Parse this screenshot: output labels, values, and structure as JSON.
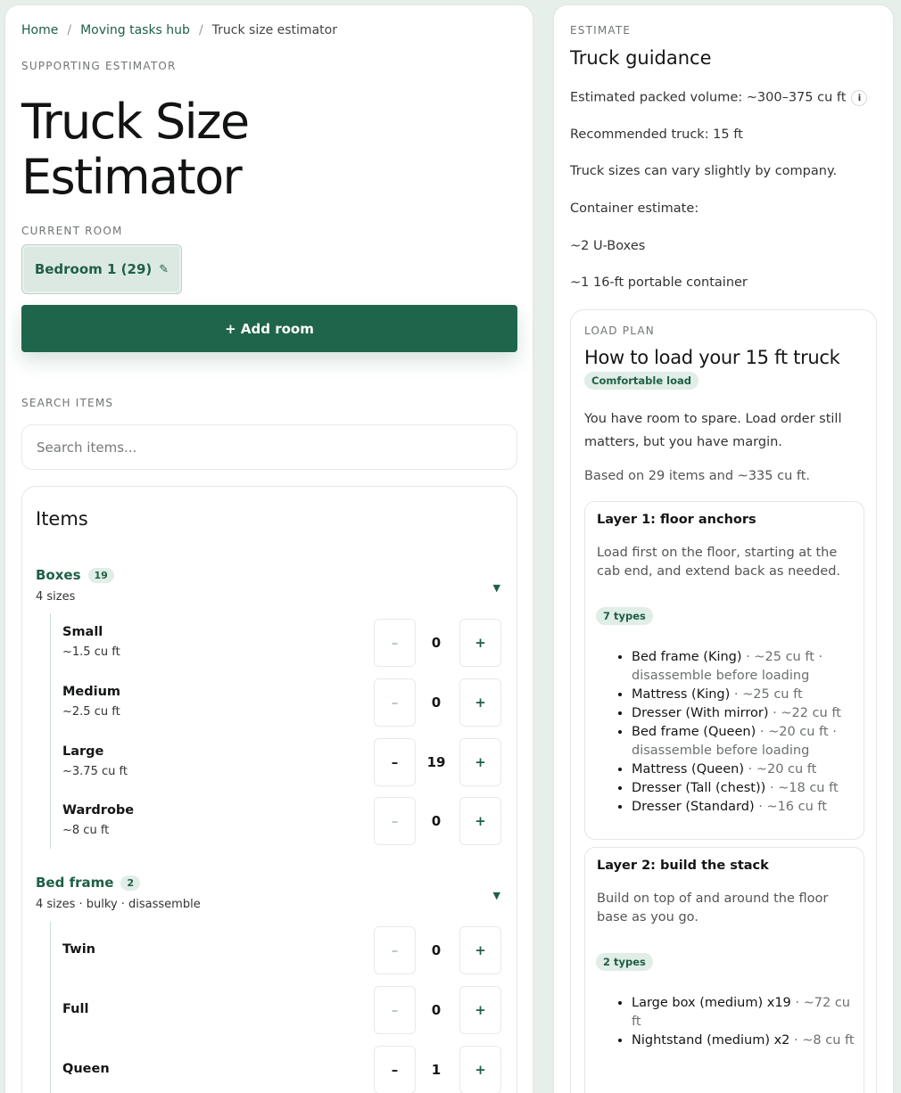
{
  "breadcrumb": [
    "Home",
    "Moving tasks hub",
    "Truck size estimator"
  ],
  "eyebrow": "SUPPORTING ESTIMATOR",
  "title_line1": "Truck Size",
  "title_line2": "Estimator",
  "current_room": {
    "label": "CURRENT ROOM",
    "name": "Bedroom 1 (29)",
    "edit_icon": "pencil-icon"
  },
  "add_room_label": "+ Add room",
  "search": {
    "label": "SEARCH ITEMS",
    "placeholder": "Search items..."
  },
  "items": {
    "heading": "Items",
    "categories": [
      {
        "name": "Boxes",
        "count": "19",
        "sub": "4 sizes",
        "rows": [
          {
            "name": "Small",
            "sub": "~1.5 cu ft",
            "qty": "0"
          },
          {
            "name": "Medium",
            "sub": "~2.5 cu ft",
            "qty": "0"
          },
          {
            "name": "Large",
            "sub": "~3.75 cu ft",
            "qty": "19"
          },
          {
            "name": "Wardrobe",
            "sub": "~8 cu ft",
            "qty": "0"
          }
        ]
      },
      {
        "name": "Bed frame",
        "count": "2",
        "sub": "4 sizes · bulky · disassemble",
        "rows": [
          {
            "name": "Twin",
            "qty": "0"
          },
          {
            "name": "Full",
            "qty": "0"
          },
          {
            "name": "Queen",
            "qty": "1"
          }
        ]
      }
    ],
    "minus": "–",
    "plus": "+"
  },
  "estimate": {
    "eyebrow": "ESTIMATE",
    "title": "Truck guidance",
    "volume": "Estimated packed volume: ~300–375 cu ft",
    "info_icon": "i",
    "recommended": "Recommended truck: 15 ft",
    "note": "Truck sizes can vary slightly by company.",
    "container_label": "Container estimate:",
    "container_1": "~2 U-Boxes",
    "container_2": "~1 16-ft portable container"
  },
  "load_plan": {
    "eyebrow": "LOAD PLAN",
    "title": "How to load your 15 ft truck",
    "badge": "Comfortable load",
    "text": "You have room to spare. Load order still matters, but you have margin.",
    "based_on": "Based on 29 items and ~335 cu ft.",
    "layers": [
      {
        "title": "Layer 1: floor anchors",
        "desc": "Load first on the floor, starting at the cab end, and extend back as needed.",
        "types": "7 types",
        "items": [
          {
            "name": "Bed frame (King)",
            "meta": " · ~25 cu ft · disassemble before loading"
          },
          {
            "name": "Mattress (King)",
            "meta": " · ~25 cu ft"
          },
          {
            "name": "Dresser (With mirror)",
            "meta": " · ~22 cu ft"
          },
          {
            "name": "Bed frame (Queen)",
            "meta": " · ~20 cu ft · disassemble before loading"
          },
          {
            "name": "Mattress (Queen)",
            "meta": " · ~20 cu ft"
          },
          {
            "name": "Dresser (Tall (chest))",
            "meta": " · ~18 cu ft"
          },
          {
            "name": "Dresser (Standard)",
            "meta": " · ~16 cu ft"
          }
        ]
      },
      {
        "title": "Layer 2: build the stack",
        "desc": "Build on top of and around the floor base as you go.",
        "types": "2 types",
        "items": [
          {
            "name": "Large box (medium) x19",
            "meta": " · ~72 cu ft"
          },
          {
            "name": "Nightstand (medium) x2",
            "meta": " · ~8 cu ft"
          }
        ]
      }
    ]
  }
}
